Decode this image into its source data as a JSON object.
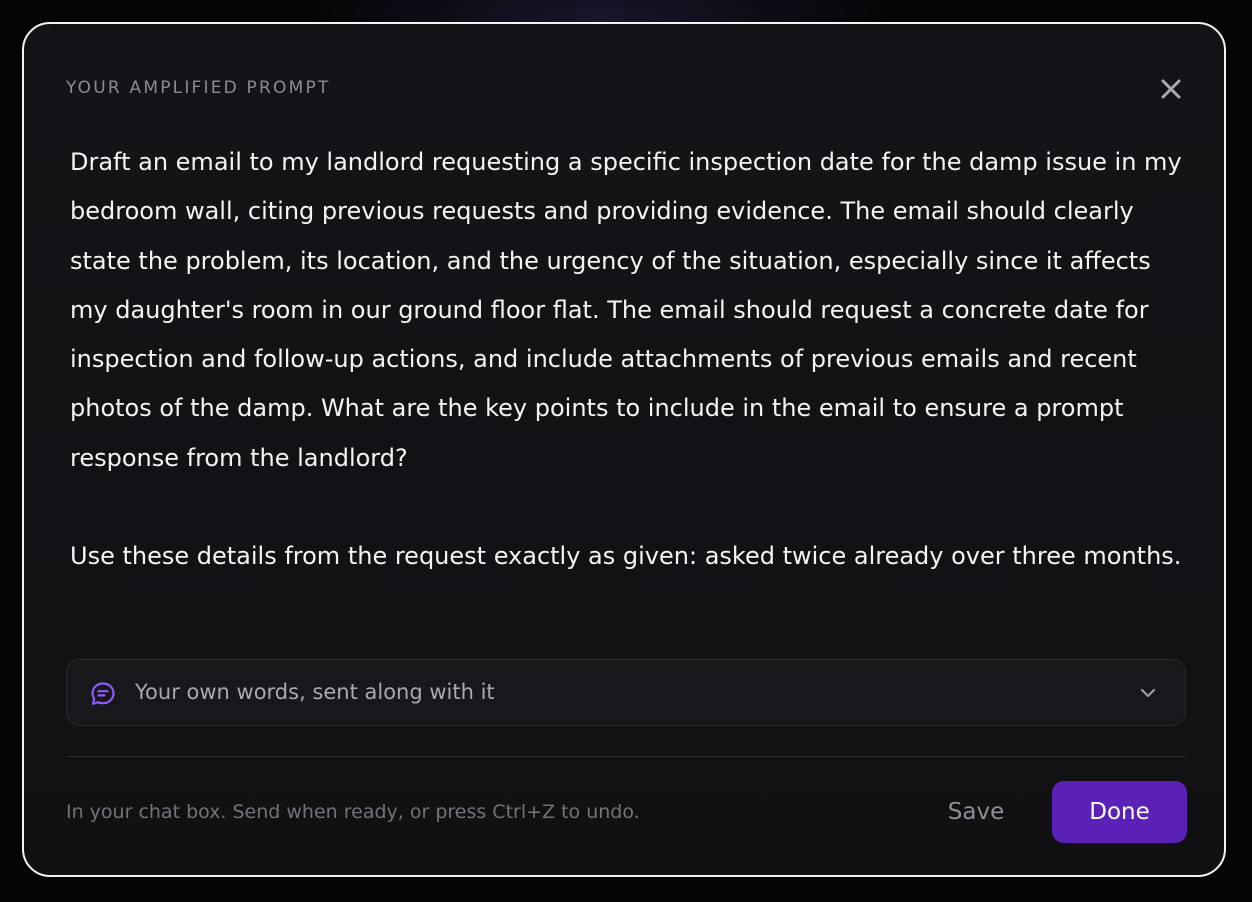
{
  "dialog": {
    "title": "YOUR AMPLIFIED PROMPT",
    "close_icon": "close-icon"
  },
  "prompt": {
    "text": "Draft an email to my landlord requesting a specific inspection date for the damp issue in my bedroom wall, citing previous requests and providing evidence. The email should clearly state the problem, its location, and the urgency of the situation, especially since it affects my daughter's room in our ground floor flat. The email should request a concrete date for inspection and follow-up actions, and include attachments of previous emails and recent photos of the damp. What are the key points to include in the email to ensure a prompt response from the landlord?\n\nUse these details from the request exactly as given: asked twice already over three months."
  },
  "own_words": {
    "label": "Your own words, sent along with it",
    "icon": "chat-bubble-icon",
    "toggle_icon": "chevron-down-icon",
    "icon_color": "#8b5cf6"
  },
  "footer": {
    "hint": "In your chat box. Send when ready, or press Ctrl+Z to undo.",
    "save_label": "Save",
    "done_label": "Done"
  },
  "colors": {
    "accent": "#5b21b6",
    "border": "#f2f2f5",
    "surface": "#121216"
  }
}
